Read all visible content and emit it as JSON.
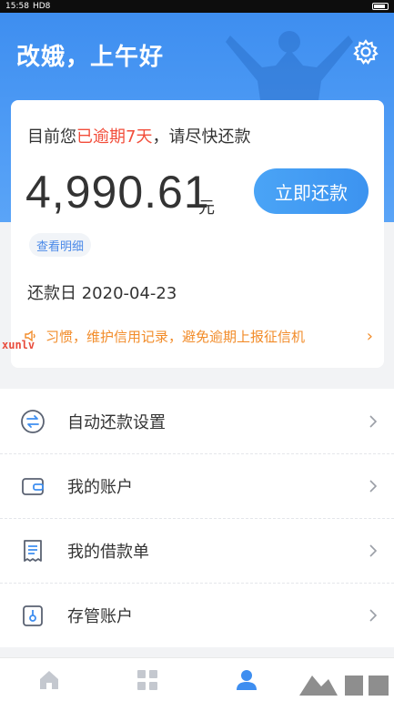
{
  "status_bar": {
    "time": "15:58",
    "network": "HD8"
  },
  "header": {
    "greeting": "改娥，上午好"
  },
  "card": {
    "overdue_prefix": "目前您",
    "overdue_highlight": "已逾期7天",
    "overdue_suffix": "，请尽快还款",
    "amount": "4,990.61",
    "unit": "元",
    "repay_button": "立即还款",
    "detail_link": "查看明细",
    "due_date": "还款日 2020-04-23",
    "notice": "习惯，维护信用记录，避免逾期上报征信机",
    "notice_arrow": "›"
  },
  "watermark": "xunlv",
  "menu": [
    {
      "label": "自动还款设置",
      "icon": "auto-repay-icon"
    },
    {
      "label": "我的账户",
      "icon": "wallet-icon"
    },
    {
      "label": "我的借款单",
      "icon": "loan-bill-icon"
    },
    {
      "label": "存管账户",
      "icon": "custody-account-icon"
    }
  ],
  "tabbar": [
    {
      "icon": "home-icon",
      "active": false
    },
    {
      "icon": "apps-icon",
      "active": false
    },
    {
      "icon": "user-icon",
      "active": true
    }
  ],
  "colors": {
    "brand_blue": "#3e8ef0",
    "overdue_red": "#f24d3a",
    "notice_orange": "#f28c2a",
    "link_blue": "#4a89e8"
  }
}
